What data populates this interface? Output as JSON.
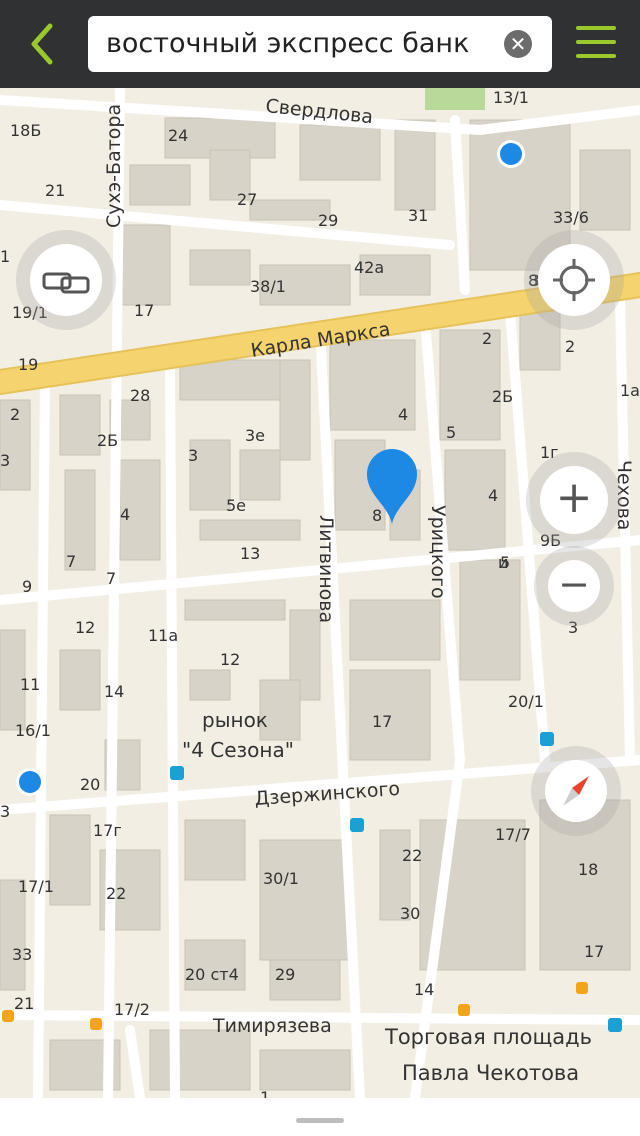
{
  "search": {
    "query": "восточный экспресс банк"
  },
  "map": {
    "streets": {
      "sverdlova": "Свердлова",
      "karla_marksa": "Карла Маркса",
      "dzerzhinskogo": "Дзержинского",
      "timiryazeva": "Тимирязева",
      "litvinova": "Литвинова",
      "uritskogo": "Урицкого",
      "chekhova": "Чехова",
      "sukhe_batora": "Сухэ-Батора"
    },
    "pois": {
      "market_line1": "рынок",
      "market_line2": "\"4 Сезона\"",
      "square_line1": "Торговая площадь",
      "square_line2": "Павла Чекотова"
    },
    "house_numbers": [
      "18Б",
      "24",
      "21",
      "27",
      "29",
      "31",
      "13/1",
      "33/6",
      "42а",
      "38/1",
      "19/1",
      "17",
      "2",
      "2",
      "3",
      "1а",
      "19",
      "28",
      "2",
      "4",
      "5",
      "2Б",
      "2Б",
      "3е",
      "3",
      "1г",
      "4",
      "5е",
      "4",
      "3",
      "13",
      "7",
      "7",
      "8",
      "5",
      "9Б",
      "3",
      "9",
      "12",
      "11а",
      "12",
      "11",
      "14",
      "16/1",
      "20/1",
      "17",
      "20",
      "17г",
      "17/7",
      "22",
      "18",
      "30/1",
      "22",
      "17/1",
      "30",
      "33",
      "20 ст4",
      "29",
      "17",
      "21",
      "17/2",
      "14",
      "1",
      "3",
      "8",
      "и",
      "1"
    ],
    "markers": {
      "result_pin": "search-result-pin"
    }
  },
  "controls": {
    "traffic": "traffic-icon",
    "locate": "locate-icon",
    "zoom_in": "+",
    "zoom_out": "−",
    "compass": "compass-icon"
  },
  "colors": {
    "topbar": "#2f3133",
    "accent": "#9ac82d",
    "road_main": "#f5d36e",
    "pin": "#1e88e5",
    "building": "#d8d3c8",
    "map_bg": "#f2eee3"
  }
}
